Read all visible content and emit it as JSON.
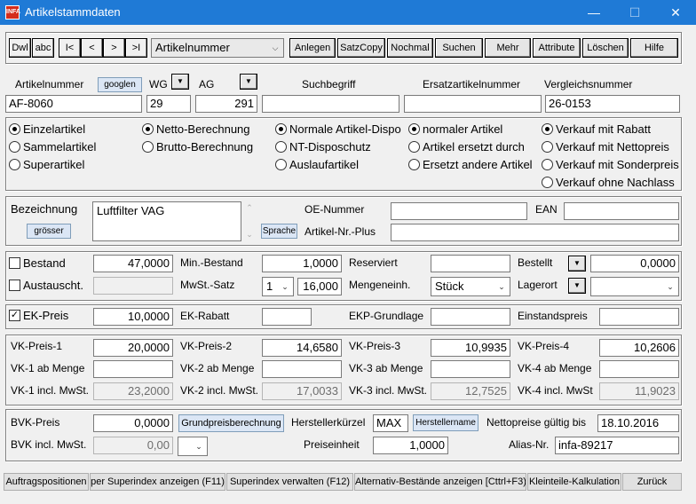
{
  "window": {
    "title": "Artikelstammdaten",
    "app_icon": "INFA"
  },
  "toolbar": {
    "nav": [
      "Dwl",
      "abc",
      "I<",
      "<",
      ">",
      ">I"
    ],
    "sort_select": "Artikelnummer",
    "actions": [
      "Anlegen",
      "SatzCopy",
      "Nochmal",
      "Suchen",
      "Mehr",
      "Attribute",
      "Löschen",
      "Hilfe"
    ]
  },
  "header": {
    "artikelnummer_label": "Artikelnummer",
    "googlen": "googlen",
    "wg_label": "WG",
    "ag_label": "AG",
    "suchbegriff_label": "Suchbegriff",
    "ersatz_label": "Ersatzartikelnummer",
    "vergleich_label": "Vergleichsnummer",
    "artikelnummer": "AF-8060",
    "wg": "29",
    "ag": "291",
    "suchbegriff": "",
    "ersatz": "",
    "vergleich": "26-0153"
  },
  "options": {
    "col1": [
      {
        "label": "Einzelartikel",
        "on": true
      },
      {
        "label": "Sammelartikel",
        "on": false
      },
      {
        "label": "Superartikel",
        "on": false
      }
    ],
    "col2": [
      {
        "label": "Netto-Berechnung",
        "on": true
      },
      {
        "label": "Brutto-Berechnung",
        "on": false
      }
    ],
    "col3": [
      {
        "label": "Normale Artikel-Dispo",
        "on": true
      },
      {
        "label": "NT-Disposchutz",
        "on": false
      },
      {
        "label": "Auslaufartikel",
        "on": false
      }
    ],
    "col4": [
      {
        "label": "normaler Artikel",
        "on": true
      },
      {
        "label": "Artikel ersetzt durch",
        "on": false
      },
      {
        "label": "Ersetzt andere Artikel",
        "on": false
      }
    ],
    "col5": [
      {
        "label": "Verkauf mit Rabatt",
        "on": true
      },
      {
        "label": "Verkauf mit Nettopreis",
        "on": false
      },
      {
        "label": "Verkauf mit Sonderpreis",
        "on": false
      },
      {
        "label": "Verkauf ohne Nachlass",
        "on": false
      }
    ]
  },
  "bezeichnung": {
    "label": "Bezeichnung",
    "groesser": "grösser",
    "text": "Luftfilter VAG",
    "sprache": "Sprache",
    "oe_label": "OE-Nummer",
    "oe": "",
    "ean_label": "EAN",
    "ean": "",
    "plus_label": "Artikel-Nr.-Plus",
    "plus": ""
  },
  "stock": {
    "bestand_label": "Bestand",
    "bestand": "47,0000",
    "austausch_label": "Austauscht.",
    "austausch": "",
    "minbestand_label": "Min.-Bestand",
    "minbestand": "1,0000",
    "mwst_label": "MwSt.-Satz",
    "mwst_code": "1",
    "mwst": "16,000",
    "reserviert_label": "Reserviert",
    "reserviert": "",
    "mengeneinh_label": "Mengeneinh.",
    "mengeneinh": "Stück",
    "bestellt_label": "Bestellt",
    "bestellt": "0,0000",
    "lagerort_label": "Lagerort",
    "lagerort": ""
  },
  "ek": {
    "ekpreis_label": "EK-Preis",
    "ekpreis": "10,0000",
    "ekrabatt_label": "EK-Rabatt",
    "ekrabatt": "",
    "ekp_label": "EKP-Grundlage",
    "ekp": "",
    "einstand_label": "Einstandspreis",
    "einstand": ""
  },
  "vk": {
    "prices": [
      {
        "label": "VK-Preis-1",
        "value": "20,0000",
        "menge_label": "VK-1 ab Menge",
        "menge": "",
        "incl_label": "VK-1 incl. MwSt.",
        "incl": "23,2000"
      },
      {
        "label": "VK-Preis-2",
        "value": "14,6580",
        "menge_label": "VK-2 ab Menge",
        "menge": "",
        "incl_label": "VK-2 incl. MwSt.",
        "incl": "17,0033"
      },
      {
        "label": "VK-Preis-3",
        "value": "10,9935",
        "menge_label": "VK-3 ab Menge",
        "menge": "",
        "incl_label": "VK-3 incl. MwSt.",
        "incl": "12,7525"
      },
      {
        "label": "VK-Preis-4",
        "value": "10,2606",
        "menge_label": "VK-4 ab Menge",
        "menge": "",
        "incl_label": "VK-4 incl. MwSt",
        "incl": "11,9023"
      }
    ]
  },
  "bvk": {
    "bvk_label": "BVK-Preis",
    "bvk": "0,0000",
    "grundpreis": "Grundpreisberechnung",
    "hersteller_label": "Herstellerkürzel",
    "hersteller": "MAX",
    "herstellername": "Herstellername",
    "netto_label": "Nettopreise gültig bis",
    "netto": "18.10.2016",
    "bvkincl_label": "BVK incl. MwSt.",
    "bvkincl": "0,00",
    "preiseinheit_label": "Preiseinheit",
    "preiseinheit": "1,0000",
    "alias_label": "Alias-Nr.",
    "alias": "infa-89217"
  },
  "bottom": [
    "Auftragspositionen",
    "per Superindex anzeigen (F11)",
    "Superindex verwalten (F12)",
    "Alternativ-Bestände anzeigen [Cttrl+F3)",
    "Kleinteile-Kalkulation",
    "Zurück"
  ]
}
